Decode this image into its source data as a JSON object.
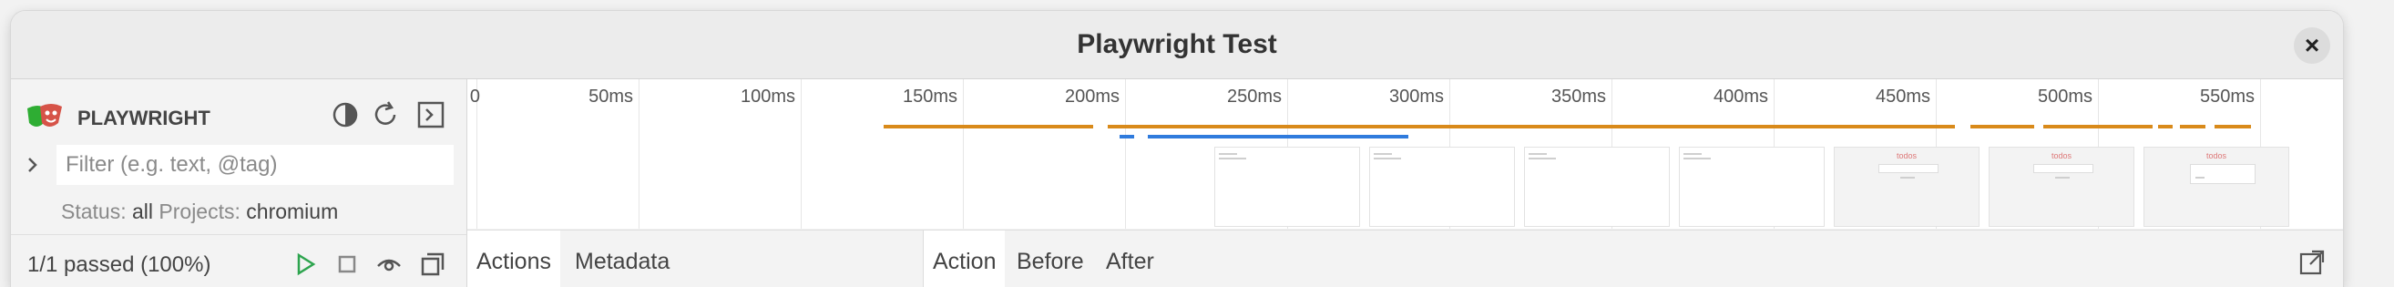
{
  "window": {
    "title": "Playwright Test",
    "close_glyph": "×"
  },
  "sidebar": {
    "brand": "PLAYWRIGHT",
    "icons": [
      "theme-toggle-icon",
      "reload-icon",
      "terminal-icon"
    ],
    "filter": {
      "placeholder": "Filter (e.g. text, @tag)",
      "value": ""
    },
    "status_label": "Status:",
    "status_value": "all",
    "projects_label": "Projects:",
    "projects_value": "chromium",
    "summary": "1/1 passed (100%)",
    "controls": [
      "run-icon",
      "stop-icon",
      "watch-icon",
      "collapse-icon"
    ]
  },
  "timeline": {
    "ticks": [
      "0",
      "50ms",
      "100ms",
      "150ms",
      "200ms",
      "250ms",
      "300ms",
      "350ms",
      "400ms",
      "450ms",
      "500ms",
      "550ms"
    ],
    "bar_colors": {
      "orange": "#d98a1a",
      "blue": "#2f7bdd"
    },
    "thumbnail_text": "todos"
  },
  "tabs_left": [
    "Actions",
    "Metadata"
  ],
  "tabs_right": [
    "Action",
    "Before",
    "After"
  ],
  "colors": {
    "accent_green": "#2da44e"
  }
}
